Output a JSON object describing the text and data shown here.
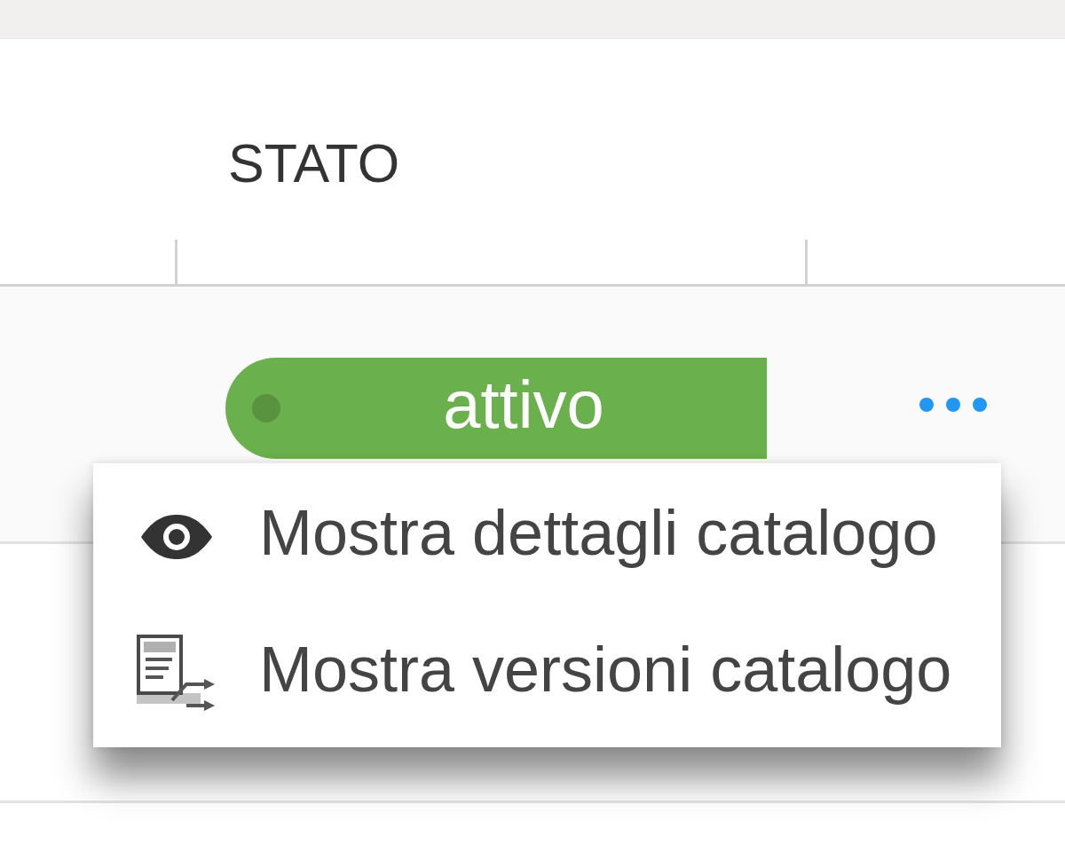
{
  "table": {
    "columns": [
      {
        "label": "STATO"
      }
    ],
    "rows": [
      {
        "status": {
          "label": "attivo",
          "color": "#6ab04c"
        }
      }
    ]
  },
  "context_menu": {
    "items": [
      {
        "kind": "details",
        "label": "Mostra dettagli catalogo"
      },
      {
        "kind": "versions",
        "label": "Mostra versioni catalogo"
      }
    ]
  }
}
